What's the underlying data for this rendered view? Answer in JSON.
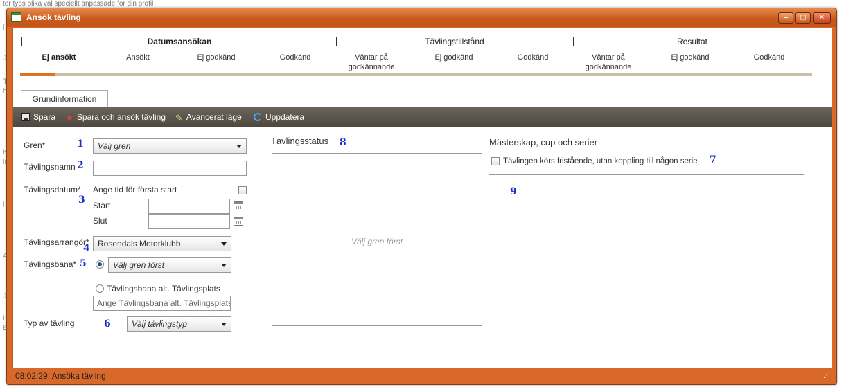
{
  "background": {
    "top_text": "ter typs olika val speciellt anpassade för din profil",
    "letters": [
      "l",
      "J",
      "T",
      "h",
      "K",
      "li",
      "l",
      "A",
      "J",
      "L",
      "E"
    ]
  },
  "window": {
    "title": "Ansök tävling",
    "controls": {
      "minimize": "‒",
      "maximize": "▢",
      "close": "✕"
    }
  },
  "progress": {
    "groups": [
      "Datumsansökan",
      "Tävlingstillstånd",
      "Resultat"
    ],
    "steps": [
      "Ej ansökt",
      "Ansökt",
      "Ej godkänd",
      "Godkänd",
      "Väntar på godkännande",
      "Ej godkänd",
      "Godkänd",
      "Väntar på godkännande",
      "Ej godkänd",
      "Godkänd"
    ],
    "active_step": 0
  },
  "tabs": [
    "Grundinformation"
  ],
  "toolbar": {
    "save": "Spara",
    "save_apply": "Spara och ansök tävling",
    "advanced": "Avancerat läge",
    "refresh": "Uppdatera"
  },
  "form": {
    "gren_label": "Gren*",
    "gren_value": "Välj gren",
    "name_label": "Tävlingsnamn",
    "name_value": "",
    "date_label": "Tävlingsdatum*",
    "first_start_label": "Ange tid för första start",
    "start_label": "Start",
    "end_label": "Slut",
    "organizer_label": "Tävlingsarrangör*",
    "organizer_value": "Rosendals Motorklubb",
    "track_label": "Tävlingsbana*",
    "track_value": "Välj gren först",
    "track_alt_label": "Tävlingsbana alt. Tävlingsplats",
    "track_alt_placeholder": "Ange Tävlingsbana alt. Tävlingsplats",
    "type_label": "Typ av tävling",
    "type_value": "Välj tävlingstyp"
  },
  "status_panel": {
    "title": "Tävlingsstatus",
    "empty_message": "Välj gren först"
  },
  "championships": {
    "title": "Mästerskap, cup och serier",
    "standalone_label": "Tävlingen körs fristående, utan koppling till någon serie"
  },
  "markers": [
    "1",
    "2",
    "3",
    "4",
    "5",
    "6",
    "7",
    "8",
    "9"
  ],
  "statusbar": {
    "text": "08:02:29: Ansöka tävling"
  },
  "colors": {
    "window_frame": "#d9692a",
    "toolbar": "#5a544a",
    "accent": "#e0701f",
    "marker": "#1a2fc8"
  }
}
